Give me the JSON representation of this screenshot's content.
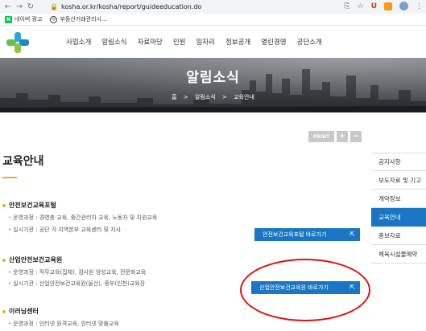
{
  "browser": {
    "url": "kosha.or.kr/kosha/report/guideeducation.do",
    "back": "←",
    "forward": "→",
    "reload": "↻",
    "lock": "🔒",
    "icons": [
      "⎘",
      "☆",
      "U",
      "⋮"
    ],
    "bookmarks": [
      {
        "icon": "N",
        "label": "네이버 광고"
      },
      {
        "icon": "◎",
        "label": "부동산거래관리시..."
      }
    ]
  },
  "site": {
    "nav": [
      "사업소개",
      "알림소식",
      "자료마당",
      "민원",
      "일자리",
      "정보공개",
      "열린경영",
      "공단소개"
    ]
  },
  "hero": {
    "title": "알림소식",
    "breadcrumb": [
      "홈",
      ">",
      "알림소식",
      ">",
      "교육안내"
    ]
  },
  "tools": {
    "print": "PRINT",
    "plus": "+",
    "minus": "−"
  },
  "content": {
    "title": "교육안내",
    "sections": [
      {
        "title": "안전보건교육포털",
        "lines": [
          {
            "label": "운영과정 :",
            "value": "경영층 교육, 중간관리자 교육, 노동자 및 지원교육"
          },
          {
            "label": "실시기관 :",
            "value": "공단 각 지역본부 교육센터 및 지사"
          }
        ],
        "button": "안전보건교육포털 바로가기"
      },
      {
        "title": "산업안전보건교육원",
        "lines": [
          {
            "label": "운영과정 :",
            "value": "직무교육(집체), 검사원 양성교육, 전문화교육"
          },
          {
            "label": "실시기관 :",
            "value": "산업안전보건교육원(울산), 중부(인천)교육장"
          }
        ],
        "button": "산업안전보건교육원 바로가기"
      },
      {
        "title": "이러닝센터",
        "lines": [
          {
            "label": "운영과정 :",
            "value": "인터넷 원격교육, 인터넷 맞춤교육"
          }
        ]
      }
    ]
  },
  "sidebar": {
    "items": [
      "공지사항",
      "보도자료 및 기고",
      "계약정보",
      "교육안내",
      "홍보자료",
      "체육시설물예약"
    ],
    "active_index": 3
  },
  "colors": {
    "accent": "#1a76c4",
    "orange": "#f5a623",
    "annotation": "#e01010"
  }
}
